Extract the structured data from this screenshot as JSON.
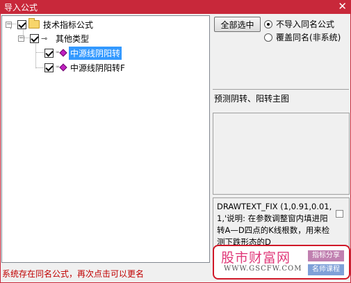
{
  "window": {
    "title": "导入公式",
    "close_glyph": "✕"
  },
  "tree": {
    "root": {
      "label": "技术指标公式",
      "expander": "−",
      "checked": true
    },
    "group": {
      "label": "其他类型",
      "expander": "−",
      "checked": true
    },
    "items": [
      {
        "label": "中源线阴阳转",
        "checked": true,
        "selected": true
      },
      {
        "label": "中源线阴阳转F",
        "checked": true,
        "selected": false
      }
    ]
  },
  "buttons": {
    "select_all": "全部选中"
  },
  "options": [
    {
      "label": "不导入同名公式",
      "selected": true
    },
    {
      "label": "覆盖同名(非系统)",
      "selected": false
    }
  ],
  "description": "预测阴转、阳转主图",
  "formula_code": "DRAWTEXT_FIX (1,0.91,0.01,1,'说明: 在参数调整窗内填进阳转A—D四点的K线根数，用来检测下跌形态的D",
  "status": "系统存在同名公式，再次点击可以更名",
  "watermark": {
    "title": "股市财富网",
    "url": "WWW.GSCFW.COM",
    "tag1": "指标分享",
    "tag2": "名师课程"
  },
  "colors": {
    "titlebar": "#c8283a",
    "selection": "#3399ff",
    "status_text": "#c00000"
  }
}
